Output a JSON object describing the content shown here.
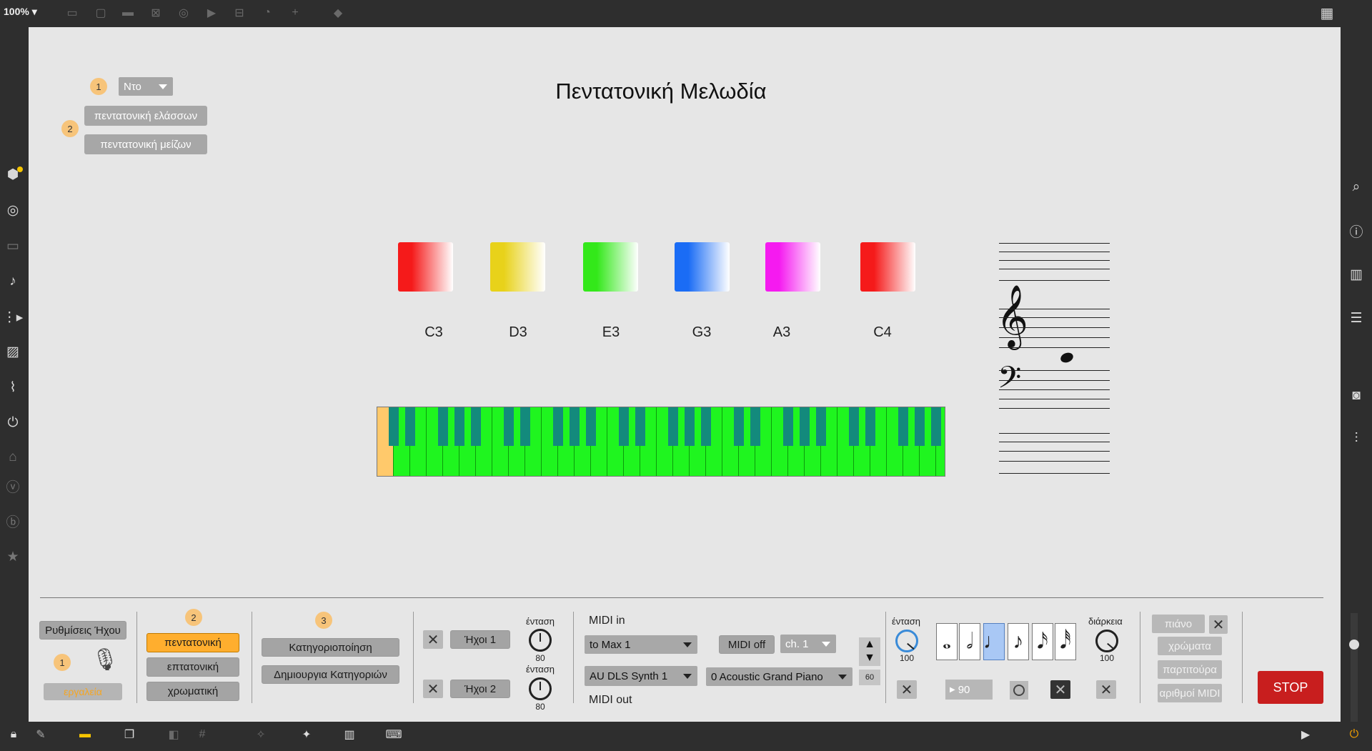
{
  "toolbar": {
    "zoom": "100%"
  },
  "patch": {
    "title": "Πεντατονική Μελωδία",
    "steps": {
      "one": "1",
      "two": "2",
      "three": "3"
    },
    "key_select": "Ντο",
    "minor_button": "πεντατονική ελάσσων",
    "major_button": "πεντατονική μείζων",
    "notes": [
      {
        "name": "C3",
        "color": "#f51a1a"
      },
      {
        "name": "D3",
        "color": "#e8d21a"
      },
      {
        "name": "E3",
        "color": "#33e81a"
      },
      {
        "name": "G3",
        "color": "#1a6cf5"
      },
      {
        "name": "A3",
        "color": "#f51af0"
      },
      {
        "name": "C4",
        "color": "#f51a1a"
      }
    ],
    "keyboard": {
      "key_color": "#1ff51f",
      "highlight": "#ffc96b"
    }
  },
  "bottom": {
    "audio_settings": "Ρυθμίσεις Ήχου",
    "tools_label": "εργαλεία",
    "scale_buttons": [
      "πεντατονική",
      "επτατονική",
      "χρωματική"
    ],
    "classify": "Κατηγοριοποίηση",
    "create_categories": "Δημιουργια Κατηγοριών",
    "sound1": "Ήχοι 1",
    "sound2": "Ήχοι 2",
    "volume_label": "ένταση",
    "volume1": "80",
    "volume2": "80",
    "midi_in_label": "MIDI in",
    "midi_out_label": "MIDI out",
    "midi_in_device": "to Max 1",
    "midi_out_device": "AU DLS Synth 1",
    "midi_toggle": "MIDI off",
    "channel": "ch. 1",
    "instrument": "0 Acoustic Grand Piano",
    "pitch_value": "60",
    "volume3": "100",
    "tempo": "90",
    "duration_label": "διάρκεια",
    "duration_value": "100",
    "view_buttons": [
      "πιάνο",
      "χρώματα",
      "παρτιτούρα",
      "αριθμοί MIDI"
    ],
    "stop": "STOP"
  }
}
